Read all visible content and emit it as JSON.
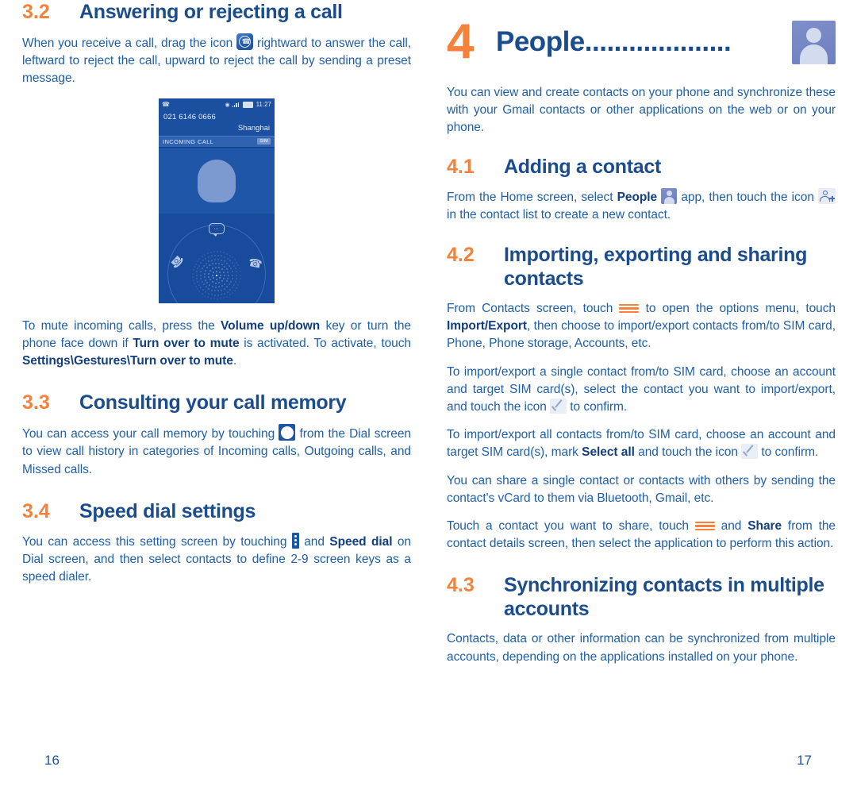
{
  "document": {
    "colors": {
      "heading_blue": "#1B4C8C",
      "accent_orange": "#F5823B",
      "body_blue": "#1F5FA9",
      "phone_ui_blue": "#1B4FA0"
    }
  },
  "left_page": {
    "page_number": "16",
    "sections": [
      {
        "number": "3.2",
        "title": "Answering or rejecting a call",
        "paragraph_1_part_a": "When you receive a call, drag the icon ",
        "icon_1": "answer-call-icon",
        "paragraph_1_part_b": " rightward to answer the call, leftward to reject the call, upward to reject the call by sending a preset message.",
        "note_part_a": "To mute incoming calls, press the ",
        "note_bold_1": "Volume up/down",
        "note_part_b": " key or turn the phone face down if ",
        "note_bold_2": "Turn over to mute",
        "note_part_c": " is activated. To activate, touch ",
        "note_bold_3": "Settings\\Gestures\\Turn over to mute",
        "note_part_d": "."
      },
      {
        "number": "3.3",
        "title": "Consulting your call memory",
        "paragraph_part_a": "You can access your call memory by touching ",
        "icon": "clock-icon",
        "paragraph_part_b": " from the Dial screen to view call history in categories of Incoming calls, Outgoing calls, and Missed calls."
      },
      {
        "number": "3.4",
        "title": "Speed dial settings",
        "paragraph_part_a": "You can access this setting screen by touching ",
        "icon": "overflow-menu-icon",
        "paragraph_part_b": " and ",
        "bold_1": "Speed dial",
        "paragraph_part_c": " on Dial screen, and then select contacts to define 2-9 screen keys as a speed dialer."
      }
    ],
    "phone_screenshot": {
      "status_bar": {
        "call_icon": "phone-handset-icon",
        "location_icon": "location-icon",
        "signal_icon": "signal-bars-icon",
        "battery_icon": "battery-icon",
        "time": "11:27"
      },
      "caller_number": "021 6146 0666",
      "caller_location": "Shanghai",
      "banner_label": "INCOMING CALL",
      "banner_chip": "SIM",
      "avatar": "default-contact-avatar",
      "actions": {
        "message": "message-icon",
        "decline": "decline-call-icon",
        "answer": "answer-call-icon"
      }
    }
  },
  "right_page": {
    "page_number": "17",
    "chapter": {
      "number": "4",
      "title": "People",
      "leader": "....................",
      "icon": "people-app-icon"
    },
    "intro": "You can view and create contacts on your phone and synchronize these with your Gmail contacts or other applications on the web or on your phone.",
    "sections": [
      {
        "number": "4.1",
        "title": "Adding a contact",
        "paragraph_part_a": "From the Home screen, select ",
        "bold_1": "People",
        "icon_1": "people-app-icon",
        "paragraph_part_b": " app, then touch the icon ",
        "icon_2": "add-contact-icon",
        "paragraph_part_c": " in the contact list to create a new contact."
      },
      {
        "number": "4.2",
        "title": "Importing, exporting and sharing contacts",
        "paragraphs": [
          {
            "part_a": "From Contacts screen, touch ",
            "icon": "options-menu-icon",
            "part_b": " to open the options menu, touch ",
            "bold_1": "Import/Export",
            "part_c": ", then choose to import/export contacts from/to SIM card, Phone, Phone storage, Accounts, etc."
          },
          {
            "part_a": "To import/export a single contact from/to SIM card, choose an account and target SIM card(s), select the contact you want to import/export, and touch the icon ",
            "icon": "check-icon",
            "part_b": " to confirm."
          },
          {
            "part_a": "To import/export all contacts from/to SIM card, choose an account and target SIM card(s), mark ",
            "bold_1": "Select all",
            "part_b": " and touch the icon ",
            "icon": "check-icon",
            "part_c": " to confirm."
          },
          {
            "part_a": "You can share a single contact or contacts with others by sending the contact's vCard to them via Bluetooth, Gmail, etc."
          },
          {
            "part_a": "Touch a contact you want to share, touch ",
            "icon": "options-menu-icon",
            "part_b": " and ",
            "bold_1": "Share",
            "part_c": " from the contact details screen, then select the application to perform this action."
          }
        ]
      },
      {
        "number": "4.3",
        "title": "Synchronizing contacts in multiple accounts",
        "paragraph": "Contacts, data or other information can be synchronized from multiple accounts, depending on the applications installed on your phone."
      }
    ]
  }
}
